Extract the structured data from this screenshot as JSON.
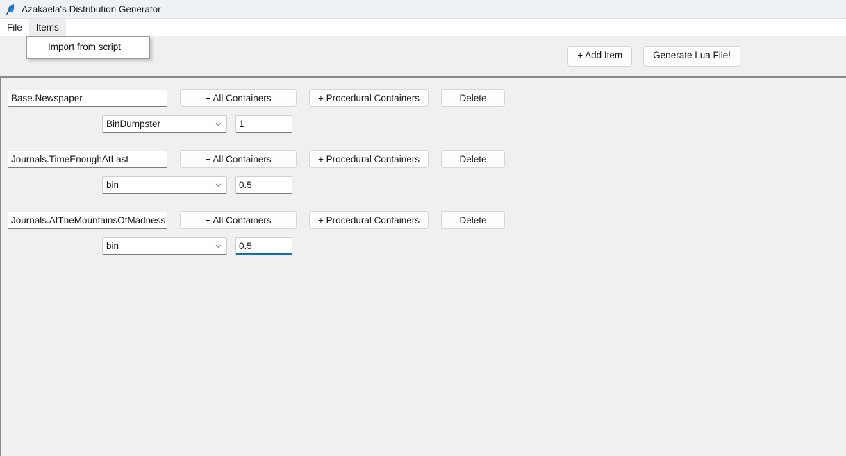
{
  "window": {
    "title": "Azakaela's Distribution Generator",
    "icon": "feather-quill-icon"
  },
  "menubar": {
    "items": [
      {
        "label": "File",
        "active": false
      },
      {
        "label": "Items",
        "active": true
      }
    ]
  },
  "dropdown": {
    "open": true,
    "items": [
      {
        "label": "Import from script"
      }
    ]
  },
  "toolbar": {
    "add_item_label": "+ Add Item",
    "generate_label": "Generate Lua File!"
  },
  "row_buttons": {
    "all_containers": "+ All Containers",
    "procedural_containers": "+ Procedural Containers",
    "delete": "Delete"
  },
  "items": [
    {
      "name": "Base.Newspaper",
      "container": "BinDumpster",
      "value": "1",
      "value_focused": false
    },
    {
      "name": "Journals.TimeEnoughAtLast",
      "container": "bin",
      "value": "0.5",
      "value_focused": false
    },
    {
      "name": "Journals.AtTheMountainsOfMadness",
      "container": "bin",
      "value": "0.5",
      "value_focused": true
    }
  ],
  "colors": {
    "titlebar": "#eef2f6",
    "body": "#f0f0f0",
    "panel_border": "#8a8a8a",
    "focus_accent": "#0f6cbd",
    "menu_active": "#ededed"
  }
}
